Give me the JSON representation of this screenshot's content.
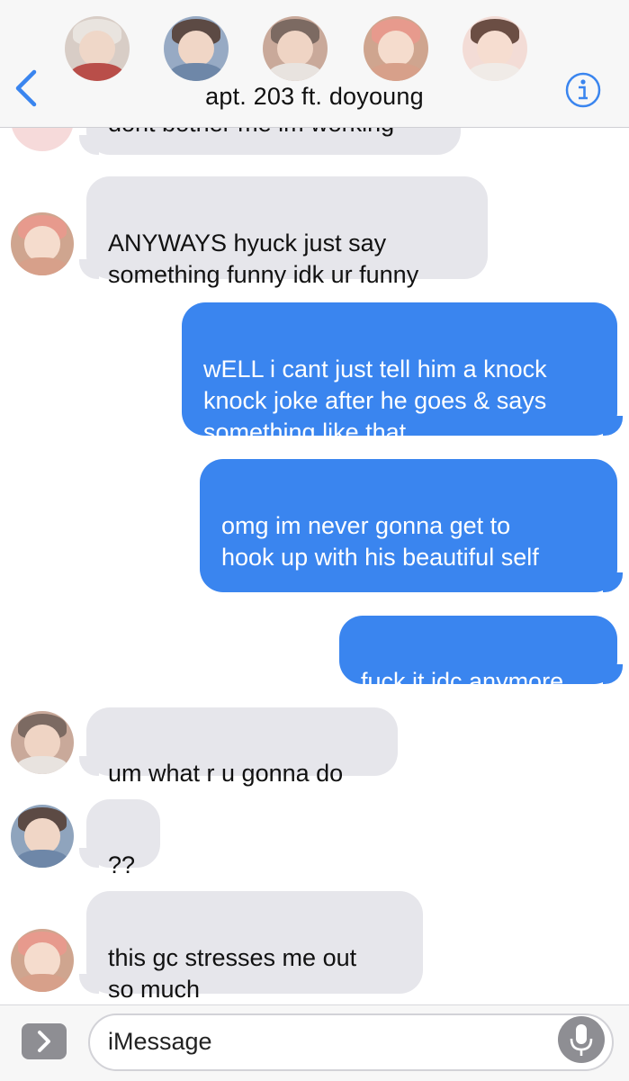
{
  "conversation": {
    "title": "apt. 203 ft. doyoung",
    "participants": [
      "member-1",
      "member-2",
      "member-3",
      "member-4",
      "member-5"
    ]
  },
  "messages": [
    {
      "side": "received",
      "text": "dont bother me im working"
    },
    {
      "side": "received",
      "text": "ANYWAYS hyuck just say\nsomething funny idk ur funny"
    },
    {
      "side": "sent",
      "text": "wELL i cant just tell him a knock\nknock joke after he goes & says\nsomething like that"
    },
    {
      "side": "sent",
      "text": "omg im never gonna get to\nhook up with his beautiful self"
    },
    {
      "side": "sent",
      "text": "fuck it idc anymore"
    },
    {
      "side": "received",
      "text": "um what r u gonna do"
    },
    {
      "side": "received",
      "text": "??"
    },
    {
      "side": "received",
      "text": "this gc stresses me out\nso much"
    }
  ],
  "emoji_line": "😔😔😔😔",
  "compose": {
    "placeholder": "iMessage"
  },
  "icons": {
    "back": "chevron-left-icon",
    "info": "info-icon",
    "expand": "chevron-right-icon",
    "mic": "microphone-icon"
  },
  "colors": {
    "accent": "#3a85ef",
    "received_bubble": "#e6e6eb",
    "header_bg": "#f7f7f7"
  }
}
